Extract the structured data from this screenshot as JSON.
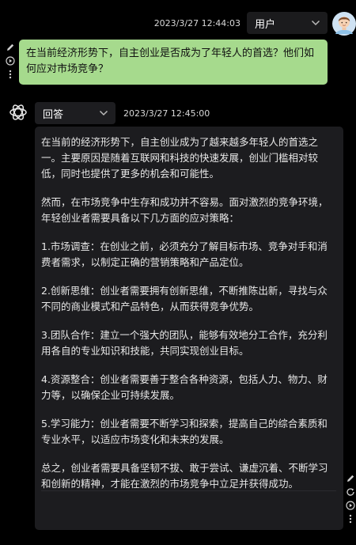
{
  "user_message": {
    "timestamp": "2023/3/27 12:44:03",
    "role_selected": "用户",
    "text": "在当前经济形势下，自主创业是否成为了年轻人的首选？他们如何应对市场竞争？"
  },
  "bot_message": {
    "timestamp": "2023/3/27 12:45:00",
    "role_selected": "回答",
    "paragraphs": [
      "在当前的经济形势下，自主创业成为了越来越多年轻人的首选之一。主要原因是随着互联网和科技的快速发展，创业门槛相对较低，同时也提供了更多的机会和可能性。",
      "然而，在市场竞争中生存和成功并不容易。面对激烈的竞争环境，年轻创业者需要具备以下几方面的应对策略：",
      "1.市场调查：在创业之前，必须充分了解目标市场、竞争对手和消费者需求，以制定正确的营销策略和产品定位。",
      "2.创新思维：创业者需要拥有创新思维，不断推陈出新，寻找与众不同的商业模式和产品特色，从而获得竞争优势。",
      "3.团队合作：建立一个强大的团队，能够有效地分工合作，充分利用各自的专业知识和技能，共同实现创业目标。",
      "4.资源整合：创业者需要善于整合各种资源，包括人力、物力、财力等，以确保企业可持续发展。",
      "5.学习能力：创业者需要不断学习和探索，提高自己的综合素质和专业水平，以适应市场变化和未来的发展。",
      "总之，创业者需要具备坚韧不拔、敢于尝试、谦虚沉着、不断学习和创新的精神，才能在激烈的市场竞争中立足并获得成功。"
    ]
  },
  "icons": {
    "user_tools": [
      "pencil-icon",
      "play-icon",
      "more-vertical-icon"
    ],
    "bot_tools": [
      "pencil-icon",
      "refresh-icon",
      "play-icon",
      "more-vertical-icon"
    ]
  },
  "colors": {
    "background": "#000000",
    "user_bubble": "#a6da8d",
    "bot_card": "#1c1c1f",
    "select_bg": "#1b1b1d"
  }
}
